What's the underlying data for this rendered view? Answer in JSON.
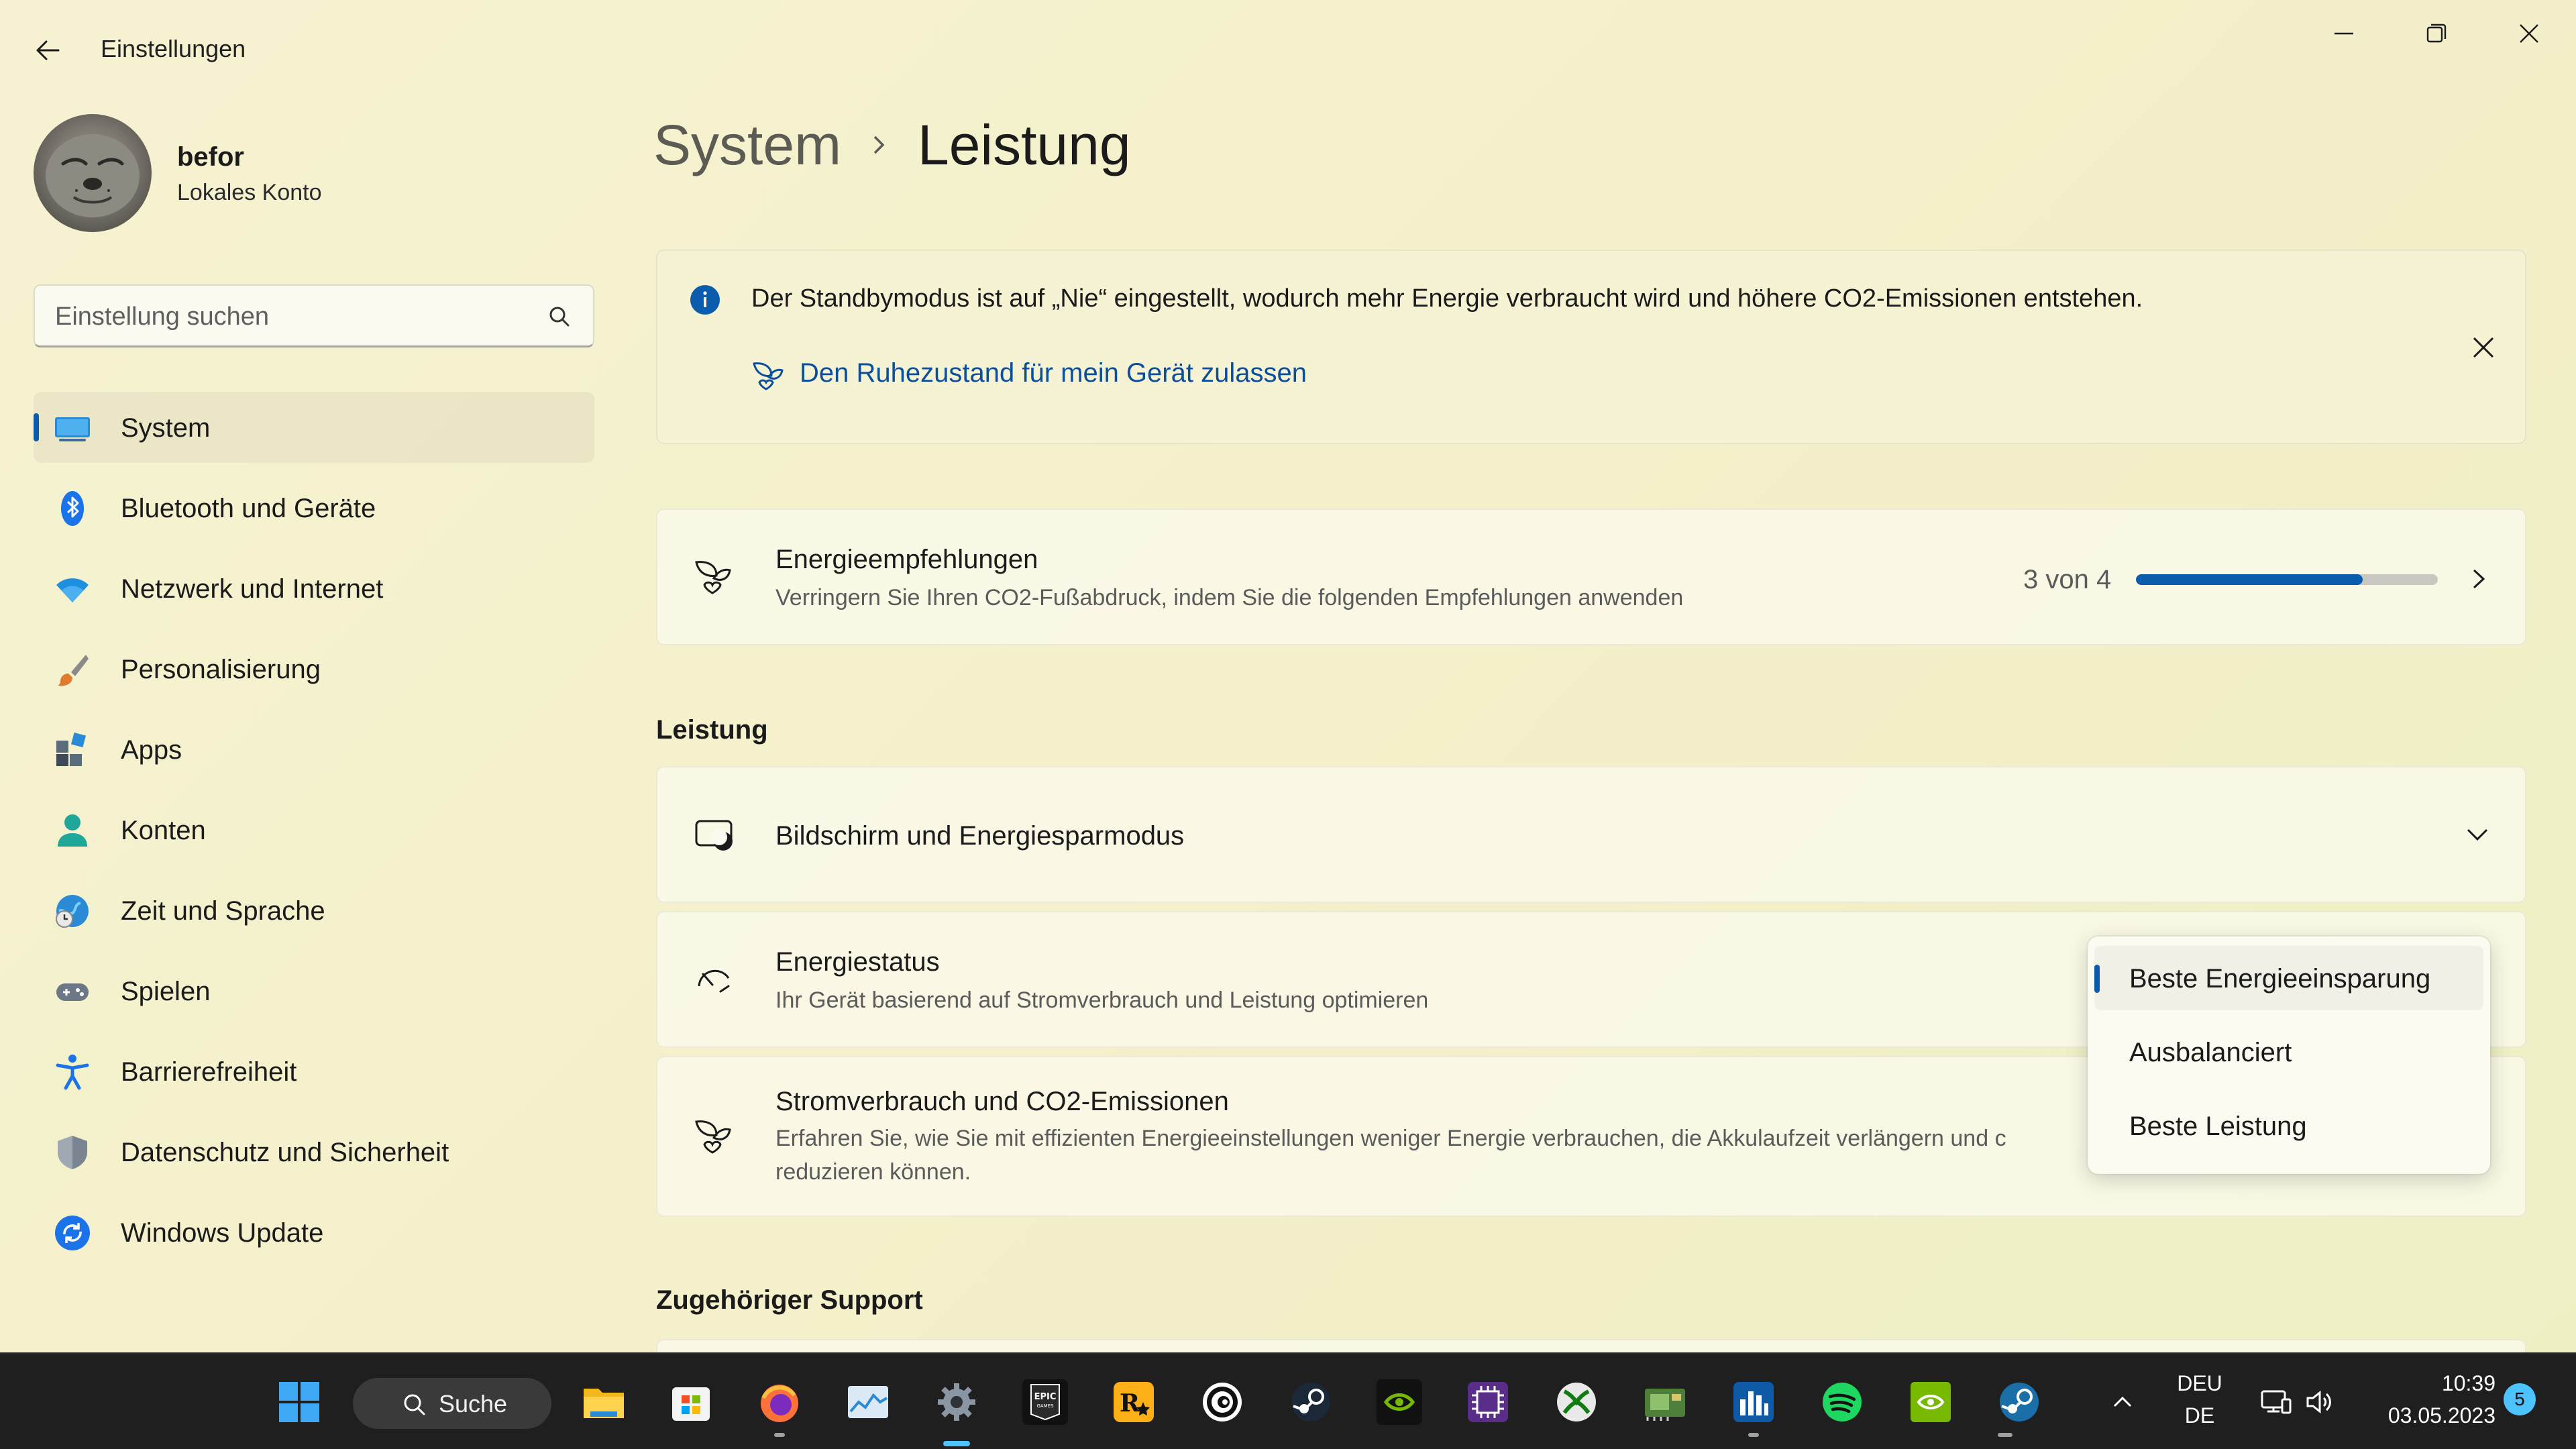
{
  "window": {
    "title": "Einstellungen",
    "back_label": "←"
  },
  "user": {
    "name": "befor",
    "account_type": "Lokales Konto"
  },
  "search": {
    "placeholder": "Einstellung suchen"
  },
  "sidebar": {
    "items": [
      {
        "label": "System",
        "icon": "monitor-icon",
        "active": true
      },
      {
        "label": "Bluetooth und Geräte",
        "icon": "bluetooth-icon"
      },
      {
        "label": "Netzwerk und Internet",
        "icon": "wifi-icon"
      },
      {
        "label": "Personalisierung",
        "icon": "brush-icon"
      },
      {
        "label": "Apps",
        "icon": "apps-icon"
      },
      {
        "label": "Konten",
        "icon": "person-icon"
      },
      {
        "label": "Zeit und Sprache",
        "icon": "globe-clock-icon"
      },
      {
        "label": "Spielen",
        "icon": "gamepad-icon"
      },
      {
        "label": "Barrierefreiheit",
        "icon": "accessibility-icon"
      },
      {
        "label": "Datenschutz und Sicherheit",
        "icon": "shield-icon"
      },
      {
        "label": "Windows Update",
        "icon": "update-icon"
      }
    ]
  },
  "breadcrumb": {
    "parent": "System",
    "current": "Leistung"
  },
  "info_bar": {
    "message": "Der Standbymodus ist auf „Nie“ eingestellt, wodurch mehr Energie verbraucht wird und höhere CO2-Emissionen entstehen.",
    "link": "Den Ruhezustand für mein Gerät zulassen"
  },
  "recommendations": {
    "title": "Energieempfehlungen",
    "subtitle": "Verringern Sie Ihren CO2-Fußabdruck, indem Sie die folgenden Empfehlungen anwenden",
    "progress_text": "3 von 4",
    "progress_fraction": 0.75
  },
  "sections": {
    "performance": "Leistung",
    "support": "Zugehöriger Support"
  },
  "screen_sleep": {
    "title": "Bildschirm und Energiesparmodus"
  },
  "power_mode": {
    "title": "Energiestatus",
    "subtitle": "Ihr Gerät basierend auf Stromverbrauch und Leistung optimieren",
    "options": [
      "Beste Energieeinsparung",
      "Ausbalanciert",
      "Beste Leistung"
    ],
    "selected": "Beste Energieeinsparung"
  },
  "co2": {
    "title": "Stromverbrauch und CO2-Emissionen",
    "subtitle_line1": "Erfahren Sie, wie Sie mit effizienten Energieeinstellungen weniger Energie verbrauchen, die Akkulaufzeit verlängern und c",
    "subtitle_line2": "reduzieren können."
  },
  "taskbar": {
    "search_label": "Suche",
    "lang_line1": "DEU",
    "lang_line2": "DE",
    "time": "10:39",
    "date": "03.05.2023",
    "notification_count": "5"
  },
  "colors": {
    "accent": "#0b5cad",
    "taskbar_accent": "#4cc2ff"
  }
}
